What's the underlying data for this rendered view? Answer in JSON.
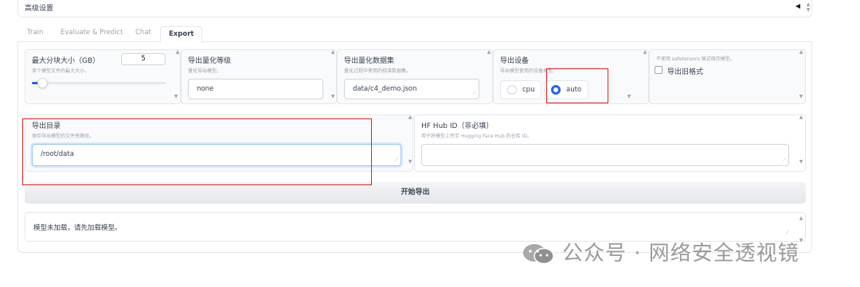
{
  "advanced": {
    "title": "高级设置",
    "caret": "◀"
  },
  "tabs": [
    {
      "label": "Train"
    },
    {
      "label": "Evaluate & Predict"
    },
    {
      "label": "Chat"
    },
    {
      "label": "Export"
    }
  ],
  "max_shard_size": {
    "label": "最大分块大小（GB）",
    "info": "单个模型文件的最大大小。",
    "value": "5",
    "slider_fraction": 0.08
  },
  "quant_bit": {
    "label": "导出量化等级",
    "info": "量化导出模型。",
    "value": "none"
  },
  "quant_dataset": {
    "label": "导出量化数据集",
    "info": "量化过程中使用的校准数据集。",
    "value": "data/c4_demo.json"
  },
  "export_device": {
    "label": "导出设备",
    "info": "导出模型使用的设备类型。",
    "options": [
      {
        "label": "cpu",
        "selected": false
      },
      {
        "label": "auto",
        "selected": true
      }
    ]
  },
  "legacy_format": {
    "info": "不使用 safetensors 格式保存模型。",
    "label": "导出旧格式",
    "checked": false
  },
  "export_dir": {
    "label": "导出目录",
    "info": "保存导出模型的文件夹路径。",
    "value": "/root/data"
  },
  "hub_id": {
    "label": "HF Hub ID（非必填）",
    "info": "用于将模型上传至 Hugging Face Hub 的仓库 ID。",
    "value": ""
  },
  "export_button": {
    "label": "开始导出"
  },
  "output": {
    "value": "模型未加载，请先加载模型。"
  },
  "watermark": {
    "text": "公众号 · 网络安全透视镜"
  },
  "annotation_color": "#e02020",
  "accent_color": "#2563eb"
}
